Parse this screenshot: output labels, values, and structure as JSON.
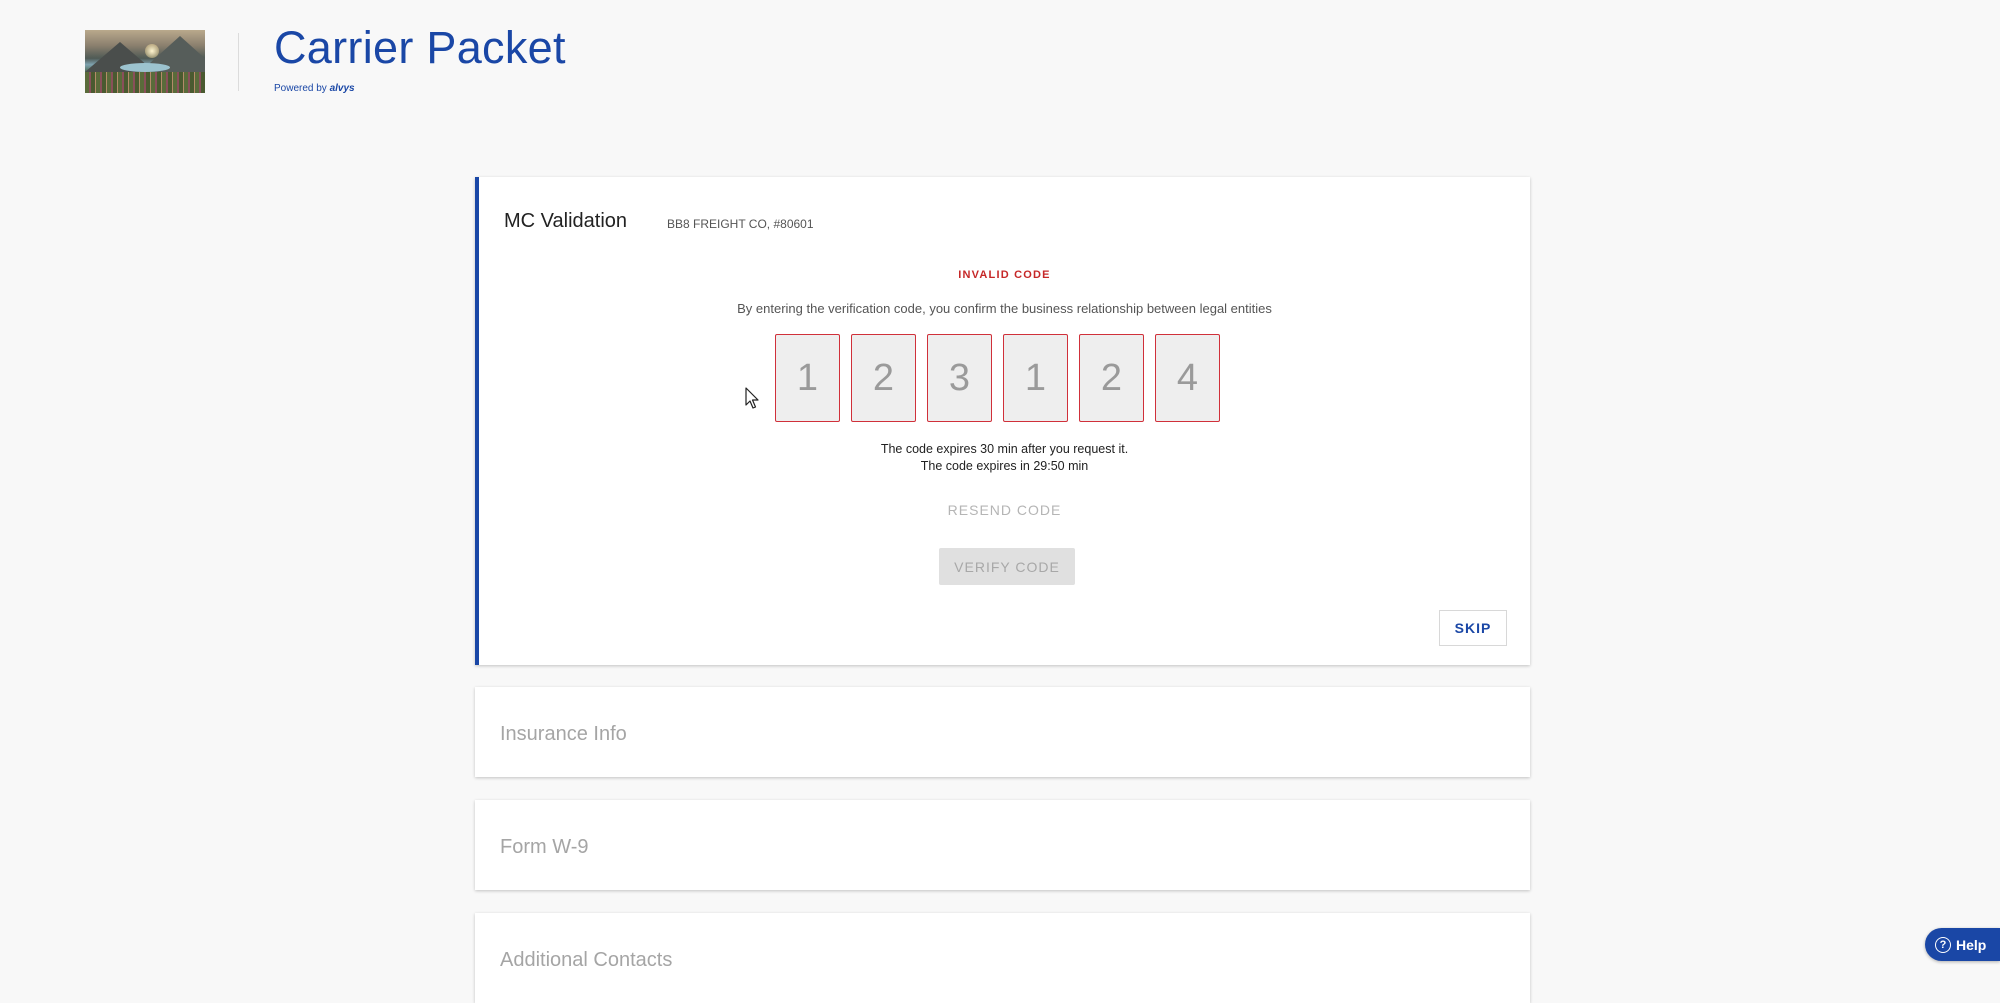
{
  "header": {
    "title": "Carrier Packet",
    "powered_prefix": "Powered by",
    "powered_brand": "alvys"
  },
  "mc_validation": {
    "title": "MC Validation",
    "company": "BB8 FREIGHT CO, #80601",
    "error": "INVALID CODE",
    "confirm_text": "By entering the verification code, you confirm the business relationship between legal entities",
    "code_digits": [
      "1",
      "2",
      "3",
      "1",
      "2",
      "4"
    ],
    "expire_note": "The code expires 30 min after you request it.",
    "expire_countdown": "The code expires in 29:50 min",
    "resend_label": "RESEND CODE",
    "verify_label": "VERIFY CODE",
    "skip_label": "SKIP"
  },
  "sections": [
    {
      "title": "Insurance Info"
    },
    {
      "title": "Form W-9"
    },
    {
      "title": "Additional Contacts"
    }
  ],
  "help": {
    "label": "Help",
    "icon": "?"
  },
  "colors": {
    "brand": "#1a47a6",
    "error": "#c62828"
  }
}
